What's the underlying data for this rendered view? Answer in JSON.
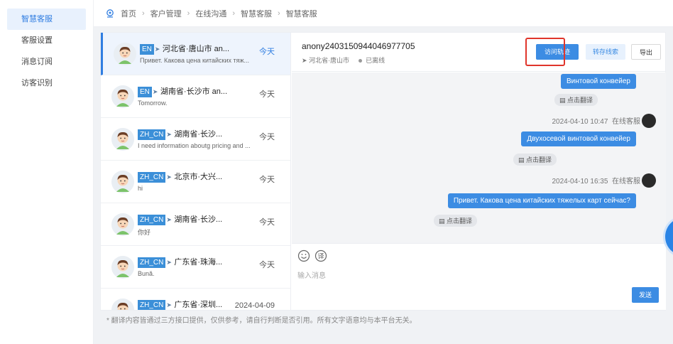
{
  "sidebar": {
    "items": [
      {
        "label": "智慧客服",
        "active": true
      },
      {
        "label": "客服设置",
        "active": false
      },
      {
        "label": "消息订阅",
        "active": false
      },
      {
        "label": "访客识别",
        "active": false
      }
    ]
  },
  "breadcrumb": [
    "首页",
    "客户管理",
    "在线沟通",
    "智慧客服",
    "智慧客服"
  ],
  "conversations": [
    {
      "lang": "EN",
      "location": "河北省·唐山市 an...",
      "date": "今天",
      "preview": "Привет. Какова цена китайских тяж...",
      "active": true
    },
    {
      "lang": "EN",
      "location": "湖南省·长沙市 an...",
      "date": "今天",
      "preview": "Tomorrow.",
      "active": false
    },
    {
      "lang": "ZH_CN",
      "location": "湖南省·长沙...",
      "date": "今天",
      "preview": "I need information aboutg pricing and ...",
      "active": false
    },
    {
      "lang": "ZH_CN",
      "location": "北京市·大兴...",
      "date": "今天",
      "preview": "hi",
      "active": false
    },
    {
      "lang": "ZH_CN",
      "location": "湖南省·长沙...",
      "date": "今天",
      "preview": "你好",
      "active": false
    },
    {
      "lang": "ZH_CN",
      "location": "广东省·珠海...",
      "date": "今天",
      "preview": "Bună.",
      "active": false
    },
    {
      "lang": "ZH_CN",
      "location": "广东省·深圳...",
      "date": "2024-04-09",
      "preview": "",
      "active": false
    }
  ],
  "chat": {
    "visitor_id": "anony2403150944046977705",
    "location": "河北省·唐山市",
    "status": "已离线",
    "visit_track_label": "访问轨迹",
    "transfer_label": "转存线索",
    "export_label": "导出",
    "messages": [
      {
        "text": "Винтовой конвейер",
        "translate": "点击翻译"
      },
      {
        "time": "2024-04-10 10:47",
        "agent": "在线客服",
        "text": "Двухосевой винтовой конвейер",
        "translate": "点击翻译"
      },
      {
        "time": "2024-04-10 16:35",
        "agent": "在线客服",
        "text": "Привет. Какова цена китайских тяжелых карт сейчас?",
        "translate": "点击翻译"
      }
    ],
    "input_placeholder": "输入消息",
    "send_label": "发送"
  },
  "footer_note": "* 翻译内容皆通过三方接口提供，仅供参考，请自行判断是否引用。所有文字语意均与本平台无关。"
}
